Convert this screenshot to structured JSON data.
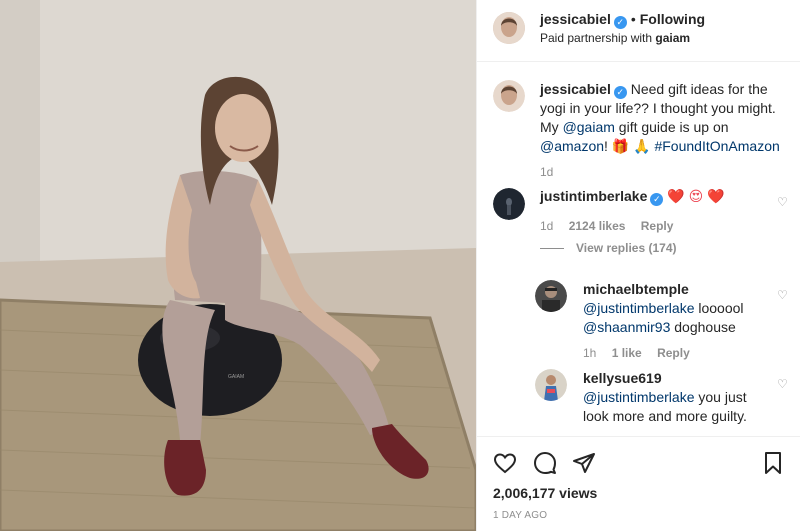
{
  "post": {
    "author": "jessicabiel",
    "following_label": "Following",
    "partnership_prefix": "Paid partnership with",
    "partner": "gaiam"
  },
  "caption": {
    "author": "jessicabiel",
    "text1": "Need gift ideas for the yogi in your life?? I thought you might. My",
    "mention1": "@gaiam",
    "text2": "gift guide is up on",
    "mention2": "@amazon",
    "text3": "! 🎁 🙏",
    "hashtag": "#FoundItOnAmazon",
    "time": "1d"
  },
  "comments": [
    {
      "author": "justintimberlake",
      "emojis": "❤️ 😍 ❤️",
      "time": "1d",
      "likes": "2124 likes",
      "reply_label": "Reply",
      "view_replies": "View replies (174)"
    },
    {
      "author": "michaelbtemple",
      "mention1": "@justintimberlake",
      "text1": "loooool",
      "mention2": "@shaanmir93",
      "text2": "doghouse",
      "time": "1h",
      "likes": "1 like",
      "reply_label": "Reply"
    },
    {
      "author": "kellysue619",
      "mention1": "@justintimberlake",
      "text1": "you just look more and more guilty."
    }
  ],
  "footer": {
    "views": "2,006,177 views",
    "posted": "1 DAY AGO"
  },
  "media": {
    "ball_logo": "GAIAM"
  },
  "icons": {
    "heart": "heart-icon",
    "comment": "comment-icon",
    "share": "share-icon",
    "bookmark": "bookmark-icon"
  }
}
